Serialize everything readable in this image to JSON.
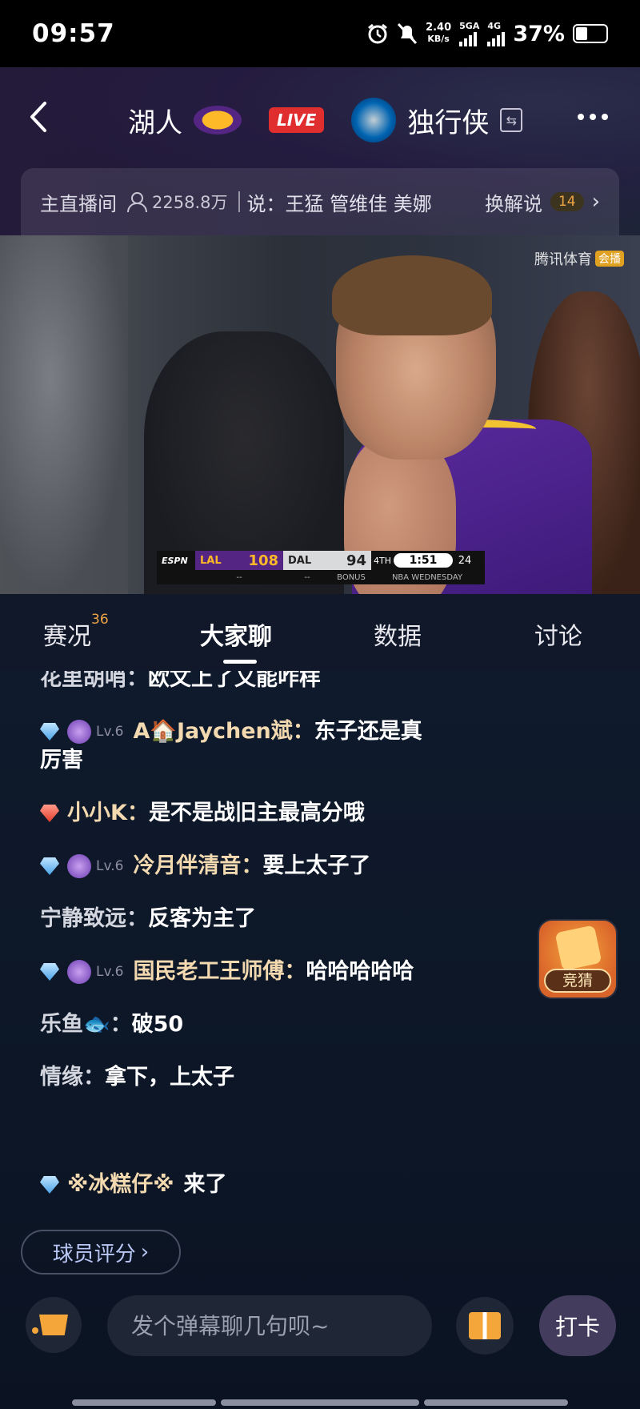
{
  "status_bar": {
    "time": "09:57",
    "net_speed": "2.40",
    "net_unit": "KB/s",
    "sim1": "5GA",
    "sim2": "4G",
    "battery": "37%"
  },
  "header": {
    "home_team": "湖人",
    "live_label": "LIVE",
    "away_team": "独行侠"
  },
  "anchor_bar": {
    "room_label": "主直播间",
    "viewers": "2258.8万",
    "commentators": "说：王猛 管维佳 美娜",
    "switch_label": "换解说",
    "switch_count": "14"
  },
  "video": {
    "watermark": "腾讯体育",
    "watermark_tag": "会播",
    "scorebug": {
      "network": "ESPN",
      "home_abbr": "LAL",
      "home_score": "108",
      "away_abbr": "DAL",
      "away_score": "94",
      "quarter": "4TH",
      "clock": "1:51",
      "shot_clock": "24",
      "home_fouls": "--",
      "away_fouls": "--",
      "bonus": "BONUS",
      "broadcast": "NBA WEDNESDAY"
    }
  },
  "tabs": [
    {
      "label": "赛况",
      "count": "36"
    },
    {
      "label": "大家聊"
    },
    {
      "label": "数据"
    },
    {
      "label": "讨论"
    }
  ],
  "chat": [
    {
      "name": "花里胡哨：",
      "text": "欧文上了又能咋样"
    },
    {
      "level": "Lv.6",
      "name": "A🏠Jaychen斌：",
      "text": "东子还是真",
      "text2": "厉害"
    },
    {
      "name": "小小K：",
      "text": "是不是战旧主最高分哦"
    },
    {
      "level": "Lv.6",
      "name": "冷月伴清音：",
      "text": "要上太子了"
    },
    {
      "name": "宁静致远：",
      "text": "反客为主了"
    },
    {
      "level": "Lv.6",
      "name": "国民老工王师傅：",
      "text": "哈哈哈哈哈"
    },
    {
      "name": "乐鱼🐟：",
      "text": "破50"
    },
    {
      "name": "情缘：",
      "text": "拿下，上太子"
    },
    {
      "name": "※冰糕仔※",
      "text": "来了"
    }
  ],
  "guess": {
    "label": "竞猜"
  },
  "player_rating": {
    "label": "球员评分",
    "arrow": "›"
  },
  "bottom": {
    "input_placeholder": "发个弹幕聊几句呗~",
    "checkin_label": "打卡"
  },
  "colors": {
    "live_red": "#e02d2d",
    "accent_orange": "#f0a545",
    "lakers_purple": "#552583",
    "lakers_gold": "#fdb927"
  }
}
